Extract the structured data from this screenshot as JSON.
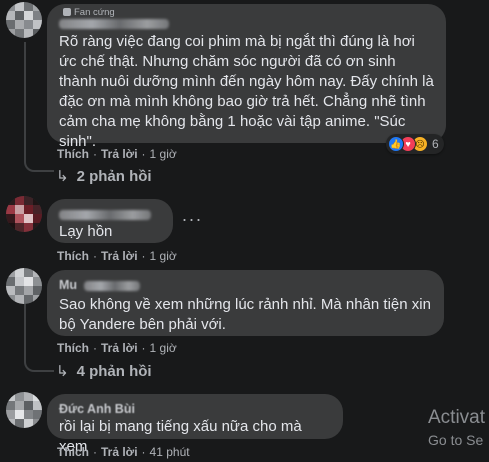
{
  "comments": [
    {
      "badge": "Fan cứng",
      "author": "",
      "text": "Rõ ràng việc đang coi phim mà bị ngắt thì đúng là hơi ức chế thật. Nhưng chăm sóc người đã có ơn sinh thành nuôi dưỡng mình đến ngày hôm nay. Đấy chính là đặc ơn mà mình không bao giờ trả hết. Chẳng nhẽ tình cảm cha mẹ không bằng 1 hoặc vài tập anime. \"Súc sinh\".",
      "like": "Thích",
      "reply": "Trả lời",
      "time": "1 giờ",
      "reaction_count": "6",
      "replies": "2 phản hồi"
    },
    {
      "author": "",
      "text": "Lạy hồn",
      "like": "Thích",
      "reply": "Trả lời",
      "time": "1 giờ",
      "more": "···"
    },
    {
      "author": "Mu",
      "text": "Sao không về xem những lúc rảnh nhỉ. Mà nhân tiện xin bộ Yandere bên phải với.",
      "like": "Thích",
      "reply": "Trả lời",
      "time": "1 giờ",
      "replies": "4 phản hồi"
    },
    {
      "author": "Đức Anh Bùi",
      "text": "rồi lại bị mang tiếng xấu nữa cho mà xem",
      "like": "Thích",
      "reply": "Trả lời",
      "time": "41 phút"
    }
  ],
  "watermark": {
    "line1": "Activat",
    "line2": "Go to Se"
  },
  "colors": {
    "background": "#18191a",
    "bubble": "#3a3b3c",
    "like": "#2078f4",
    "love": "#f33e58",
    "sad": "#f7b125"
  }
}
